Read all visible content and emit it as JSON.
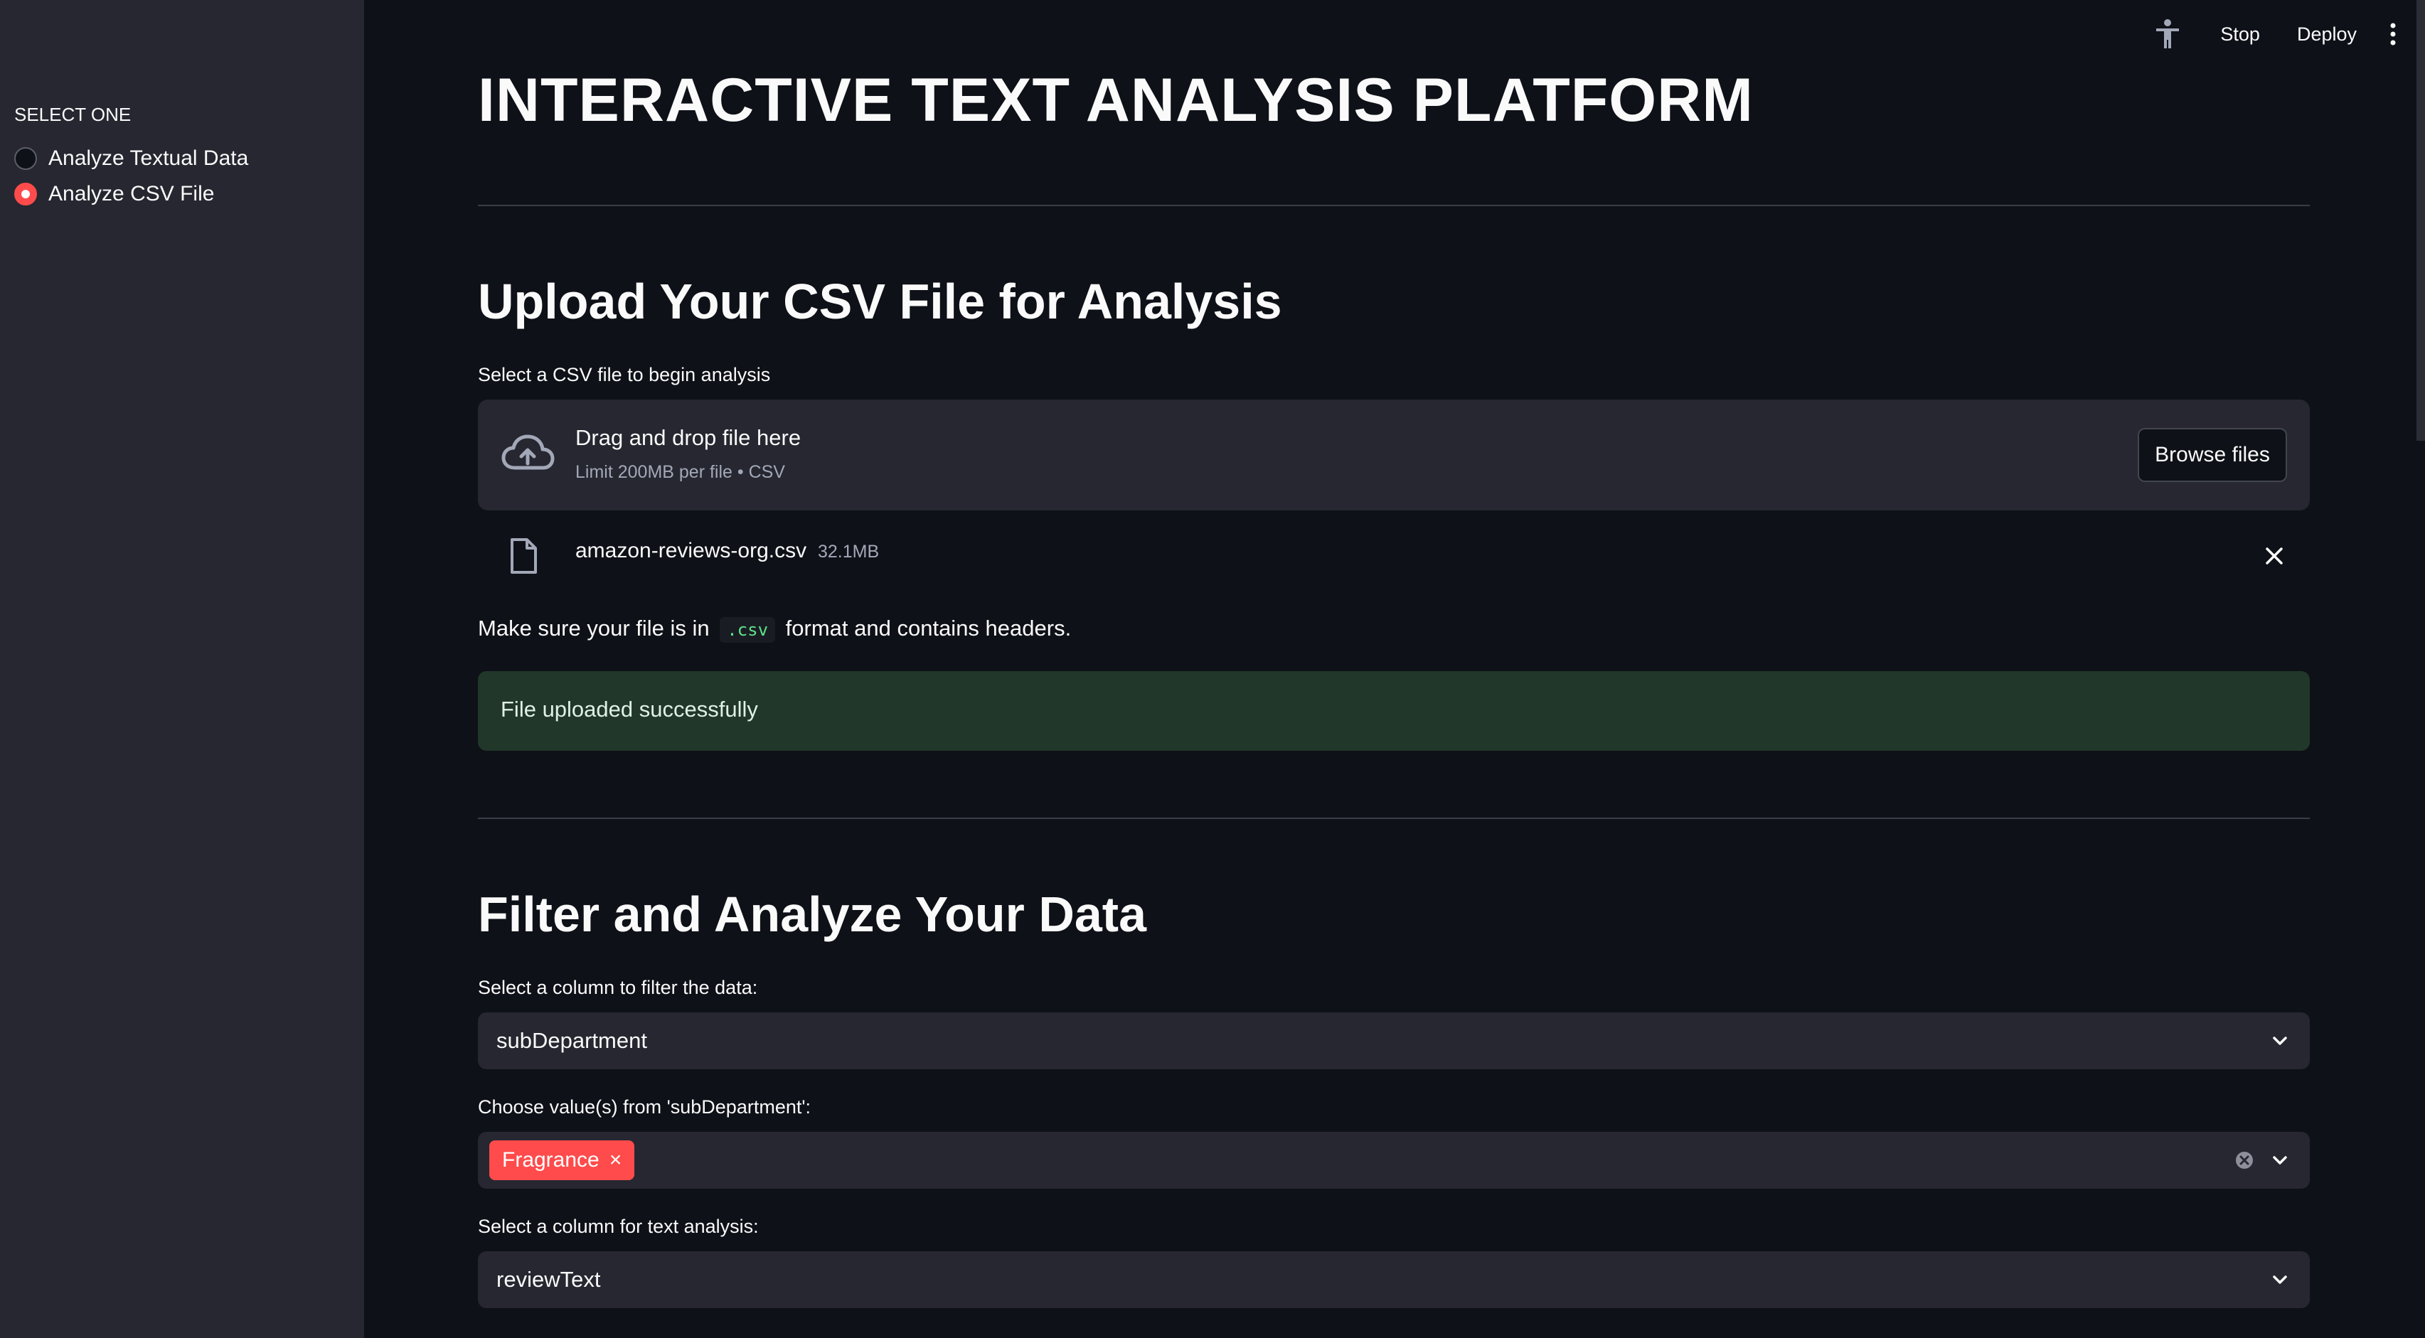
{
  "sidebar": {
    "label": "SELECT ONE",
    "options": [
      {
        "label": "Analyze Textual Data",
        "selected": false
      },
      {
        "label": "Analyze CSV File",
        "selected": true
      }
    ]
  },
  "toolbar": {
    "stop_label": "Stop",
    "deploy_label": "Deploy"
  },
  "main": {
    "title": "INTERACTIVE TEXT ANALYSIS PLATFORM",
    "upload_section": {
      "heading": "Upload Your CSV File for Analysis",
      "uploader_label": "Select a CSV file to begin analysis",
      "dropzone_main": "Drag and drop file here",
      "dropzone_sub": "Limit 200MB per file • CSV",
      "browse_label": "Browse files",
      "file_name": "amazon-reviews-org.csv",
      "file_size": "32.1MB",
      "hint_before": "Make sure your file is in",
      "hint_code": ".csv",
      "hint_after": "format and contains headers.",
      "success_message": "File uploaded successfully"
    },
    "filter_section": {
      "heading": "Filter and Analyze Your Data",
      "filter_column_label": "Select a column to filter the data:",
      "filter_column_value": "subDepartment",
      "values_label": "Choose value(s) from 'subDepartment':",
      "selected_values": [
        "Fragrance"
      ],
      "text_column_label": "Select a column for text analysis:",
      "text_column_value": "reviewText"
    }
  },
  "colors": {
    "background": "#0e1117",
    "sidebar": "#262730",
    "accent": "#ff4b4b",
    "success_bg": "#21372a",
    "code_text": "#5ce488"
  }
}
